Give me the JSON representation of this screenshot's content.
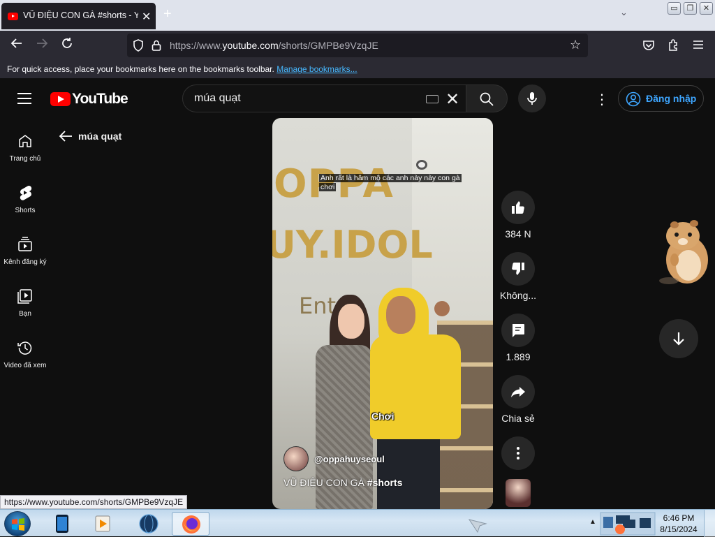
{
  "browser": {
    "tab_title": "VŨ ĐIỆU CON GÀ #shorts - YouTube",
    "tab_close": "✕",
    "new_tab": "+",
    "tab_list": "⌄",
    "url_prefix": "https://www.",
    "url_domain": "youtube.com",
    "url_path": "/shorts/GMPBe9VzqJE",
    "bookmarks_hint": "For quick access, place your bookmarks here on the bookmarks toolbar.",
    "bookmarks_link": "Manage bookmarks...",
    "window_controls": [
      "▭",
      "❐",
      "✕"
    ]
  },
  "youtube": {
    "logo_text": "YouTube",
    "search_query": "múa quạt",
    "sign_in": "Đăng nhập",
    "back_label": "múa quạt",
    "guide": [
      {
        "label": "Trang chủ",
        "icon": "home-icon"
      },
      {
        "label": "Shorts",
        "icon": "shorts-icon"
      },
      {
        "label": "Kênh đăng ký",
        "icon": "subscriptions-icon"
      },
      {
        "label": "Bạn",
        "icon": "you-icon"
      },
      {
        "label": "Video đã xem",
        "icon": "history-icon"
      }
    ]
  },
  "short": {
    "caption": "Anh rất là hâm mộ các anh này này con gà chơi",
    "sign_line1": "OPPA",
    "sign_line2": "UY.IDOL",
    "sign_line3": "Ent",
    "subtitle": "Chơi",
    "channel": "@oppahuyseoul",
    "title_text": "VŨ ĐIỆU CON GÀ ",
    "title_tag": "#shorts",
    "likes": "384 N",
    "dislike_label": "Không...",
    "comments": "1.889",
    "share_label": "Chia sẻ"
  },
  "status_url": "https://www.youtube.com/shorts/GMPBe9VzqJE",
  "taskbar": {
    "time": "6:46 PM",
    "date": "8/15/2024"
  },
  "colors": {
    "yt_red": "#ff0000",
    "link_blue": "#3ea6ff",
    "background": "#0f0f0f"
  }
}
